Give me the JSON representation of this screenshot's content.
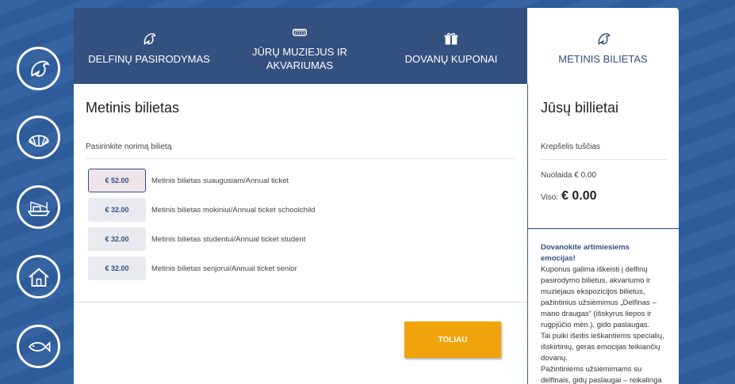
{
  "tabs": [
    {
      "label": "DELFINŲ PASIRODYMAS",
      "icon": "dolphin-icon"
    },
    {
      "label": "JŪRŲ MUZIEJUS IR AKVARIUMAS",
      "icon": "museum-icon"
    },
    {
      "label": "DOVANŲ KUPONAI",
      "icon": "gift-icon"
    },
    {
      "label": "METINIS BILIETAS",
      "icon": "dolphin-icon"
    }
  ],
  "sidebar": [
    {
      "icon": "dolphin-icon"
    },
    {
      "icon": "shell-icon"
    },
    {
      "icon": "boat-icon"
    },
    {
      "icon": "house-icon"
    },
    {
      "icon": "fish-icon"
    }
  ],
  "main": {
    "title": "Metinis bilietas",
    "choose_label": "Pasirinkite norimą bilietą",
    "tickets": [
      {
        "price": "€ 52.00",
        "label": "Metinis bilietas suaugusiam/Annual ticket",
        "selected": true
      },
      {
        "price": "€ 32.00",
        "label": "Metinis bilietas mokiniui/Annual ticket schoolchild",
        "selected": false
      },
      {
        "price": "€ 32.00",
        "label": "Metinis bilietas studentui/Annual ticket student",
        "selected": false
      },
      {
        "price": "€ 32.00",
        "label": "Metinis bilietas senjorui/Annual ticket senior",
        "selected": false
      }
    ],
    "next_label": "TOLIAU"
  },
  "cart": {
    "title": "Jūsų billietai",
    "empty": "Krepšelis tuščias",
    "discount": "Nuolaida € 0.00",
    "total_label": "Viso:",
    "total_value": "€ 0.00"
  },
  "promo": {
    "title": "Dovanokite artimiesiems emocijas!",
    "lines": [
      "Kuponus galima iškeisti į delfinų pasirodymo bilietus, akvariumo ir muziejaus ekspozicijos bilietus, pažintinius užsiėmimus „Delfinas – mano draugas“ (išskyrus liepos ir rugpjūčio mėn.), gido paslaugas.",
      "Tai puiki išeitis ieškantiems  specialių, išskirtinių, geras emocijas teikiančių dovanų.",
      "Pažintiniems užsiėmimams su delfinais, gidų paslaugai – reikalinga"
    ]
  },
  "colors": {
    "background": "#2f5f9f",
    "tab_dark": "#33507e",
    "accent_button": "#f0a30a"
  }
}
